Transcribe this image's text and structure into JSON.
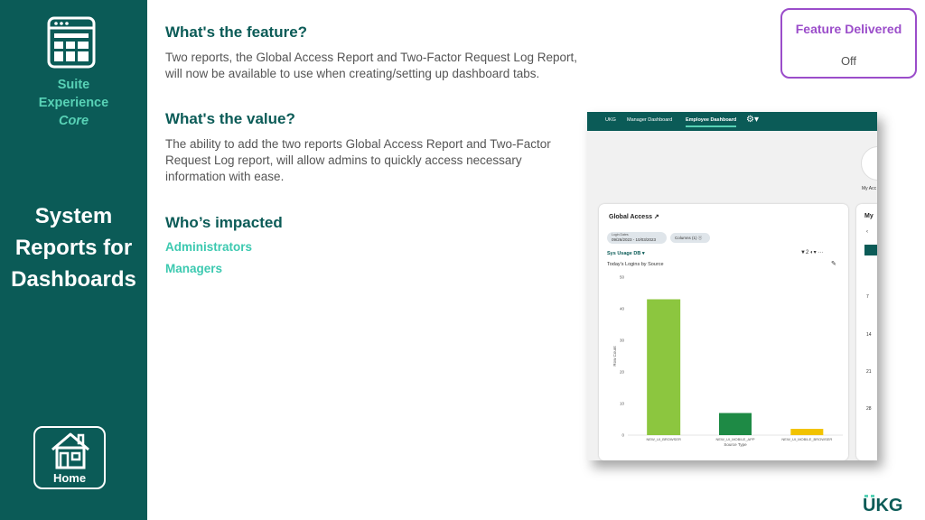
{
  "sidebar": {
    "suite_line1": "Suite",
    "suite_line2": "Experience",
    "suite_line3": "Core",
    "title_lines": [
      "System",
      "Reports for",
      "Dashboards"
    ],
    "home_label": "Home",
    "icons": {
      "brand": "dashboard-window-icon",
      "home": "home-icon"
    }
  },
  "feature": {
    "heading": "What's the feature?",
    "text_line1": "Two reports, the Global Access Report and Two-Factor Request Log Report,",
    "text_line2": "will now be available to use when creating/setting up dashboard tabs."
  },
  "value": {
    "heading": "What's the value?",
    "text_line1": "The ability to add the two reports Global Access Report and Two-Factor",
    "text_line2": "Request Log report, will allow admins to quickly access necessary",
    "text_line3": "information with ease."
  },
  "impacted": {
    "heading": "Who’s impacted",
    "items": [
      "Administrators",
      "Managers"
    ]
  },
  "feature_delivered": {
    "label": "Feature Delivered",
    "value": "Off"
  },
  "screenshot": {
    "tabs": [
      "UKG",
      "Manager Dashboard",
      "Employee Dashboard"
    ],
    "avatar_label": "My Acc",
    "card": {
      "title": "Global Access ↗",
      "date_label": "Login Dates",
      "date_value": "09/26/2023 - 10/03/2023",
      "columns_pill": "Columns (1) ⓧ",
      "sys_usage": "Sys Usage DB ▾",
      "tools": "▼2  ◐▾  ···",
      "subtitle": "Today's Logins by Source",
      "pencil": "✎"
    },
    "card2": {
      "title": "My",
      "chevron": "‹",
      "numbers": [
        "7",
        "14",
        "21",
        "28"
      ]
    }
  },
  "chart_data": {
    "type": "bar",
    "categories": [
      "NEW_UI_BROWSER",
      "NEW_UI_MOBILE_APP",
      "NEW_UI_MOBILE_BROWSER"
    ],
    "values": [
      43,
      7,
      2
    ],
    "colors": [
      "#8cc63f",
      "#1e8a45",
      "#f2c300"
    ],
    "title": "Today's Logins by Source",
    "xlabel": "Source Type",
    "ylabel": "Row Count",
    "ylim": [
      0,
      50
    ],
    "yticks": [
      0,
      10,
      20,
      30,
      40,
      50
    ]
  },
  "footer": {
    "logo_text": "UKG"
  },
  "colors": {
    "sidebar": "#0b5b57",
    "accent": "#58d2b6",
    "heading": "#0b5b57",
    "feature_border": "#9b4dca"
  }
}
